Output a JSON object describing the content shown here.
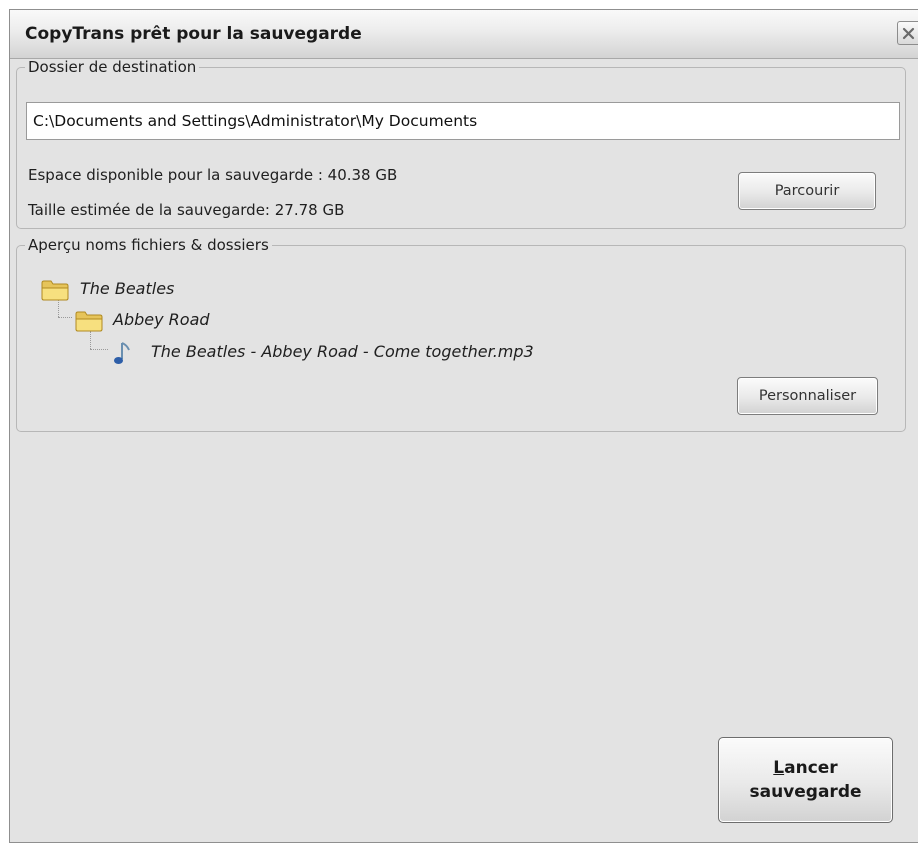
{
  "window": {
    "title": "CopyTrans prêt pour la sauvegarde"
  },
  "destination": {
    "legend": "Dossier de destination",
    "path_value": "C:\\Documents and Settings\\Administrator\\My Documents",
    "available_space": "Espace disponible pour la sauvegarde : 40.38 GB",
    "estimated_size": "Taille estimée de la sauvegarde: 27.78 GB",
    "browse_label": "Parcourir"
  },
  "preview": {
    "legend": "Aperçu noms fichiers & dossiers",
    "tree": [
      {
        "label": "The Beatles",
        "icon": "folder-icon"
      },
      {
        "label": "Abbey Road",
        "icon": "folder-icon"
      },
      {
        "label": "The Beatles - Abbey Road - Come together.mp3",
        "icon": "music-note-icon"
      }
    ],
    "customize_label": "Personnaliser"
  },
  "footer": {
    "launch_line1": "Lancer",
    "launch_line2": "sauvegarde"
  }
}
